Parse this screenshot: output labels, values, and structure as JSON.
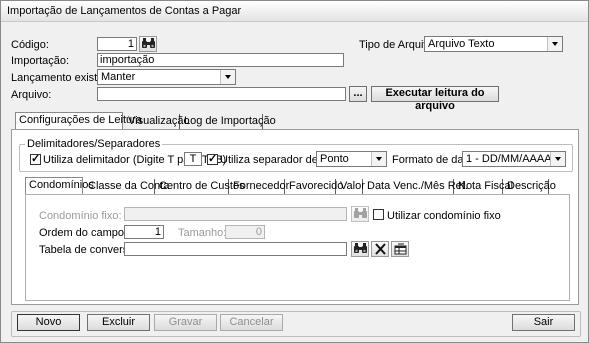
{
  "window": {
    "title": "Importação de Lançamentos de Contas a Pagar"
  },
  "header": {
    "codigo_label": "Código:",
    "codigo_value": "1",
    "tipo_arquivo_label": "Tipo de Arquivo:",
    "tipo_arquivo_value": "Arquivo Texto",
    "importacao_label": "Importação:",
    "importacao_value": "importação",
    "lancamento_label": "Lançamento existente:",
    "lancamento_value": "Manter",
    "arquivo_label": "Arquivo:",
    "arquivo_value": "",
    "browse_label": "...",
    "executar_label": "Executar leitura do arquivo"
  },
  "main_tabs": [
    {
      "label": "Configurações de Leitura",
      "active": true
    },
    {
      "label": "Visualização",
      "active": false
    },
    {
      "label": "Log de Importação",
      "active": false
    }
  ],
  "delimitadores": {
    "group_label": "Delimitadores/Separadores",
    "utiliza_delimitador_label": "Utiliza delimitador (Digite T para TAB)",
    "utiliza_delimitador_checked": true,
    "delimitador_value": "T",
    "utiliza_separador_label": "Utiliza separador decimal",
    "utiliza_separador_checked": true,
    "separador_value": "Ponto",
    "formato_data_label": "Formato de data:",
    "formato_data_value": "1 - DD/MM/AAAA"
  },
  "sub_tabs": [
    {
      "label": "Condomínios",
      "active": true
    },
    {
      "label": "Classe da Conta",
      "active": false
    },
    {
      "label": "Centro de Custos",
      "active": false
    },
    {
      "label": "Fornecedor",
      "active": false
    },
    {
      "label": "Favorecido",
      "active": false
    },
    {
      "label": "Valor",
      "active": false
    },
    {
      "label": "Data Venc./Mês Ref.",
      "active": false
    },
    {
      "label": "Nota Fiscal",
      "active": false
    },
    {
      "label": "Descrição",
      "active": false
    }
  ],
  "condominios": {
    "condominio_fixo_label": "Condomínio fixo:",
    "condominio_fixo_value": "",
    "utilizar_condominio_fixo_label": "Utilizar condomínio fixo",
    "utilizar_condominio_fixo_checked": false,
    "ordem_label": "Ordem do campo:",
    "ordem_value": "1",
    "tamanho_label": "Tamanho:",
    "tamanho_value": "0",
    "tabela_label": "Tabela de conversão:",
    "tabela_value": ""
  },
  "footer": {
    "novo_label": "Novo",
    "excluir_label": "Excluir",
    "gravar_label": "Gravar",
    "cancelar_label": "Cancelar",
    "sair_label": "Sair"
  },
  "icons": [
    "binoculars-icon",
    "close-icon",
    "table-icon"
  ]
}
